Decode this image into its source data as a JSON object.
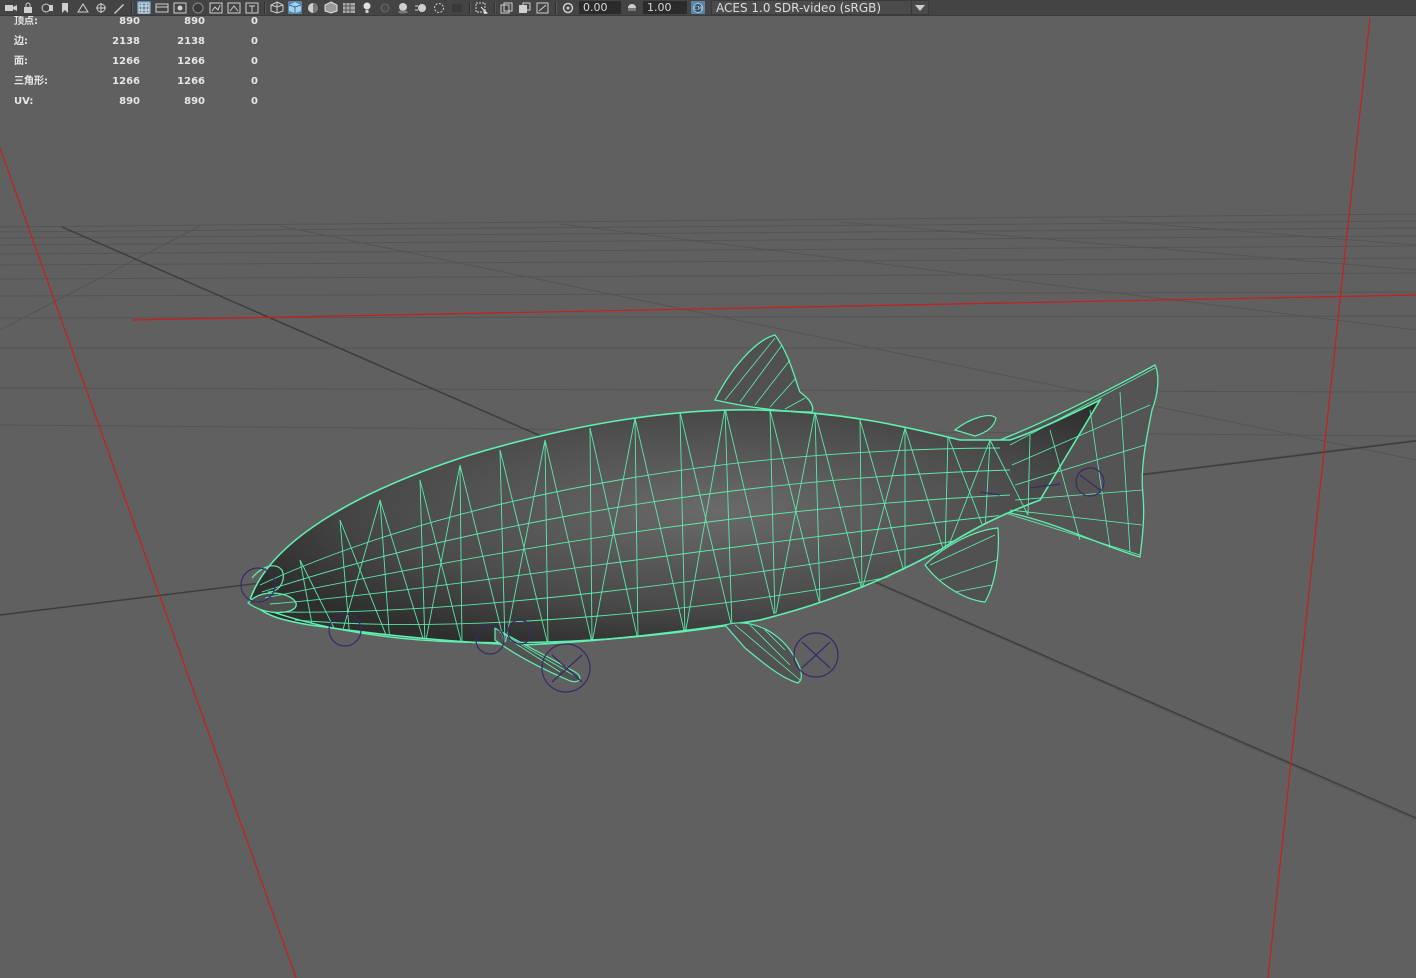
{
  "toolbar": {
    "gamma_value": "0.00",
    "exposure_value": "1.00",
    "color_space": "ACES 1.0 SDR-video (sRGB)",
    "icons": [
      "camera-icon",
      "camera-lock-icon",
      "camera-attrs-icon",
      "bookmark-icon",
      "image-plane-icon",
      "2d-pan-icon",
      "grease-pencil-icon",
      "grid-icon",
      "film-gate-icon",
      "resolution-gate-icon",
      "gate-mask-icon",
      "field-chart-icon",
      "safe-action-icon",
      "safe-title-icon",
      "wireframe-icon",
      "smooth-shade-icon",
      "use-default-material-icon",
      "wireframe-on-shaded-icon",
      "textured-icon",
      "use-all-lights-icon",
      "shadows-icon",
      "screen-space-ao-icon",
      "motion-blur-icon",
      "anti-aliasing-icon",
      "depth-of-field-icon",
      "isolate-select-icon",
      "xray-icon",
      "xray-active-components-icon",
      "xray-joints-icon",
      "backface-culling-icon",
      "gamma-icon",
      "exposure-icon",
      "color-management-icon"
    ]
  },
  "hud": {
    "rows": [
      {
        "label": "顶点:",
        "v1": "890",
        "v2": "890",
        "v3": "0"
      },
      {
        "label": "边:",
        "v1": "2138",
        "v2": "2138",
        "v3": "0"
      },
      {
        "label": "面:",
        "v1": "1266",
        "v2": "1266",
        "v3": "0"
      },
      {
        "label": "三角形:",
        "v1": "1266",
        "v2": "1266",
        "v3": "0"
      },
      {
        "label": "UV:",
        "v1": "890",
        "v2": "890",
        "v3": "0"
      }
    ]
  },
  "scene": {
    "object": "fish-mesh",
    "display_mode": "wireframe-on-shaded",
    "wire_color": "#5ff0b0",
    "joint_color": "#3a2a6a",
    "grid_color": "#4e4e4e",
    "axis_red": "#c81e1e",
    "background": "#606060"
  }
}
